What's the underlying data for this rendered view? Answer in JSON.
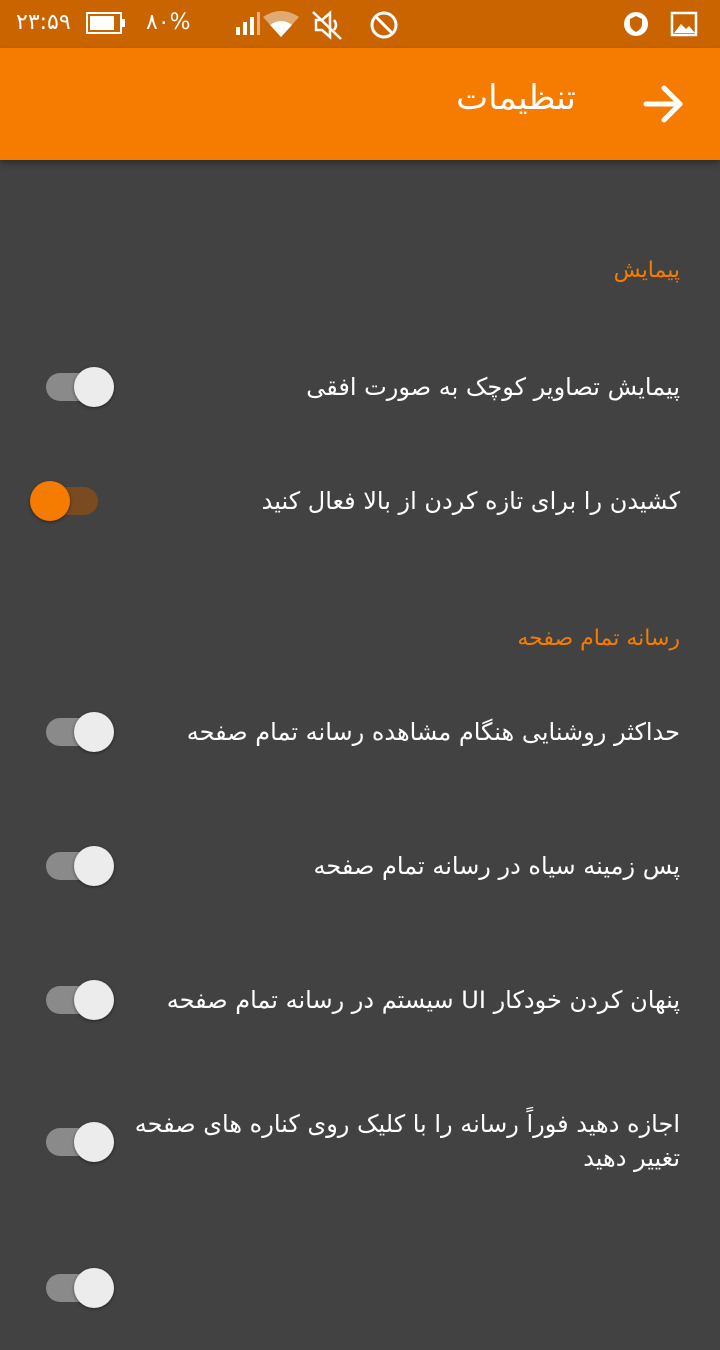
{
  "status_bar": {
    "time": "۲۳:۵۹",
    "battery_percent": "۸۰%",
    "battery_level": 0.8,
    "icons": [
      "signal-icon",
      "wifi-icon",
      "muted-icon",
      "do-not-disturb-icon",
      "shield-app-icon",
      "image-app-icon"
    ]
  },
  "app_bar": {
    "title": "تنظیمات",
    "back_icon": "arrow-right-icon"
  },
  "colors": {
    "accent": "#f57c00",
    "status_bar": "#c96400",
    "background": "#424242"
  },
  "sections": [
    {
      "header": "پیمایش",
      "items": [
        {
          "label": "پیمایش تصاویر کوچک به صورت افقی",
          "enabled": false
        },
        {
          "label": "کشیدن را برای تازه کردن از بالا فعال کنید",
          "enabled": true
        }
      ]
    },
    {
      "header": "رسانه تمام صفحه",
      "items": [
        {
          "label": "حداکثر روشنایی هنگام مشاهده رسانه تمام صفحه",
          "enabled": false
        },
        {
          "label": "پس زمینه سیاه در رسانه تمام صفحه",
          "enabled": false
        },
        {
          "label": "پنهان کردن خودکار UI سیستم در رسانه تمام صفحه",
          "enabled": false
        },
        {
          "label": "اجازه دهید فوراً رسانه را با کلیک روی کناره های صفحه تغییر دهید",
          "enabled": false
        },
        {
          "label": "",
          "enabled": false
        }
      ]
    }
  ]
}
